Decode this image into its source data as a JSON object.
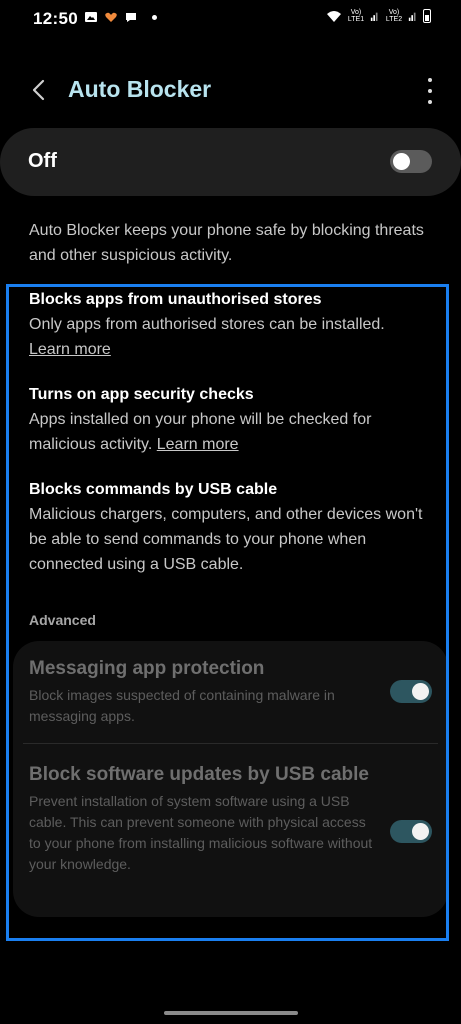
{
  "status_bar": {
    "time": "12:50",
    "network1": "Vo) LTE1",
    "network2": "Vo) LTE2",
    "icons": [
      "gallery-icon",
      "hearts-icon",
      "chat-icon",
      "dot-icon",
      "wifi-icon",
      "signal-icon",
      "battery-icon"
    ]
  },
  "app_bar": {
    "title": "Auto Blocker",
    "back_icon": "chevron-left-icon",
    "more_icon": "more-vert-icon"
  },
  "master_toggle": {
    "label": "Off",
    "state": "off"
  },
  "description": "Auto Blocker keeps your phone safe by blocking threats and other suspicious activity.",
  "features": [
    {
      "title": "Blocks apps from unauthorised stores",
      "desc": "Only apps from authorised stores can be installed.",
      "link": "Learn more"
    },
    {
      "title": "Turns on app security checks",
      "desc": "Apps installed on your phone will be checked for malicious activity.",
      "link": "Learn more"
    },
    {
      "title": "Blocks commands by USB cable",
      "desc": "Malicious chargers, computers, and other devices won't be able to send commands to your phone when connected using a USB cable."
    }
  ],
  "advanced": {
    "header": "Advanced",
    "items": [
      {
        "title": "Messaging app protection",
        "subtitle": "Block images suspected of containing malware in messaging apps.",
        "state": "on"
      },
      {
        "title": "Block software updates by USB cable",
        "subtitle": "Prevent installation of system software using a USB cable. This can prevent someone with physical access to your phone from installing malicious software without your knowledge.",
        "state": "on"
      }
    ]
  },
  "colors": {
    "accent_title": "#b8e3ee",
    "highlight_frame": "#1a7ff0",
    "toggle_on": "#2d5660",
    "toggle_off": "#5b5b5b"
  }
}
